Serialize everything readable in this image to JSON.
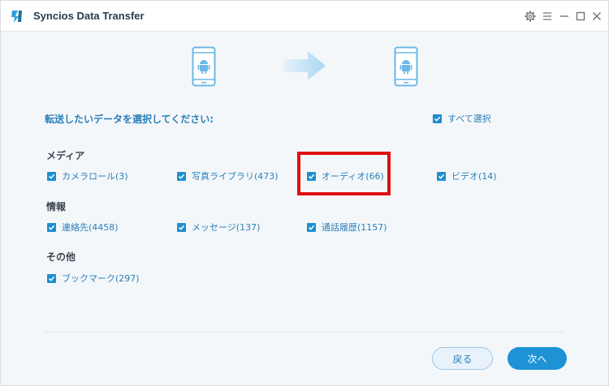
{
  "window": {
    "title": "Syncios Data Transfer"
  },
  "prompt": "転送したいデータを選択してください:",
  "select_all": {
    "label": "すべて選択",
    "checked": true
  },
  "sections": {
    "media": {
      "label": "メディア",
      "items": [
        {
          "label": "カメラロール(3)",
          "checked": true
        },
        {
          "label": "写真ライブラリ(473)",
          "checked": true
        },
        {
          "label": "オーディオ(66)",
          "checked": true
        },
        {
          "label": "ビデオ(14)",
          "checked": true
        }
      ]
    },
    "info": {
      "label": "情報",
      "items": [
        {
          "label": "連絡先(4458)",
          "checked": true
        },
        {
          "label": "メッセージ(137)",
          "checked": true
        },
        {
          "label": "通話履歴(1157)",
          "checked": true
        }
      ]
    },
    "other": {
      "label": "その他",
      "items": [
        {
          "label": "ブックマーク(297)",
          "checked": true
        }
      ]
    }
  },
  "buttons": {
    "back": "戻る",
    "next": "次へ"
  },
  "colors": {
    "accent": "#1d8fcf",
    "highlight": "#e01010",
    "device_icon": "#6cb8e6"
  },
  "icons": [
    "syncios-logo-icon",
    "gear-icon",
    "menu-icon",
    "minimize-icon",
    "maximize-icon",
    "close-icon",
    "android-phone-icon",
    "arrow-right-icon",
    "checkbox-checked-icon"
  ]
}
